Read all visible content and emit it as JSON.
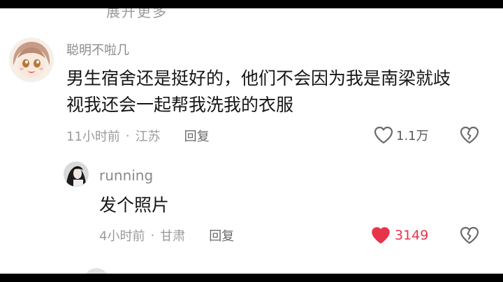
{
  "top_partial_text": "展开更多",
  "comments": [
    {
      "username": "聪明不啦几",
      "text_line1": "男生宿舍还是挺好的，他们不会因为我是南梁就歧",
      "text_line2": "视我还会一起帮我洗我的衣服",
      "time": "11小时前",
      "separator": "·",
      "location": "江苏",
      "reply_label": "回复",
      "likes": "1.1万",
      "liked": false
    },
    {
      "username": "running",
      "text": "发个照片",
      "time": "4小时前",
      "separator": "·",
      "location": "甘肃",
      "reply_label": "回复",
      "likes": "3149",
      "liked": true
    }
  ],
  "colors": {
    "like_active": "#e8344b",
    "text_primary": "#161616",
    "text_secondary": "#9a9a9a"
  },
  "icons": {
    "like": "heart-icon",
    "dislike": "broken-heart-icon"
  }
}
